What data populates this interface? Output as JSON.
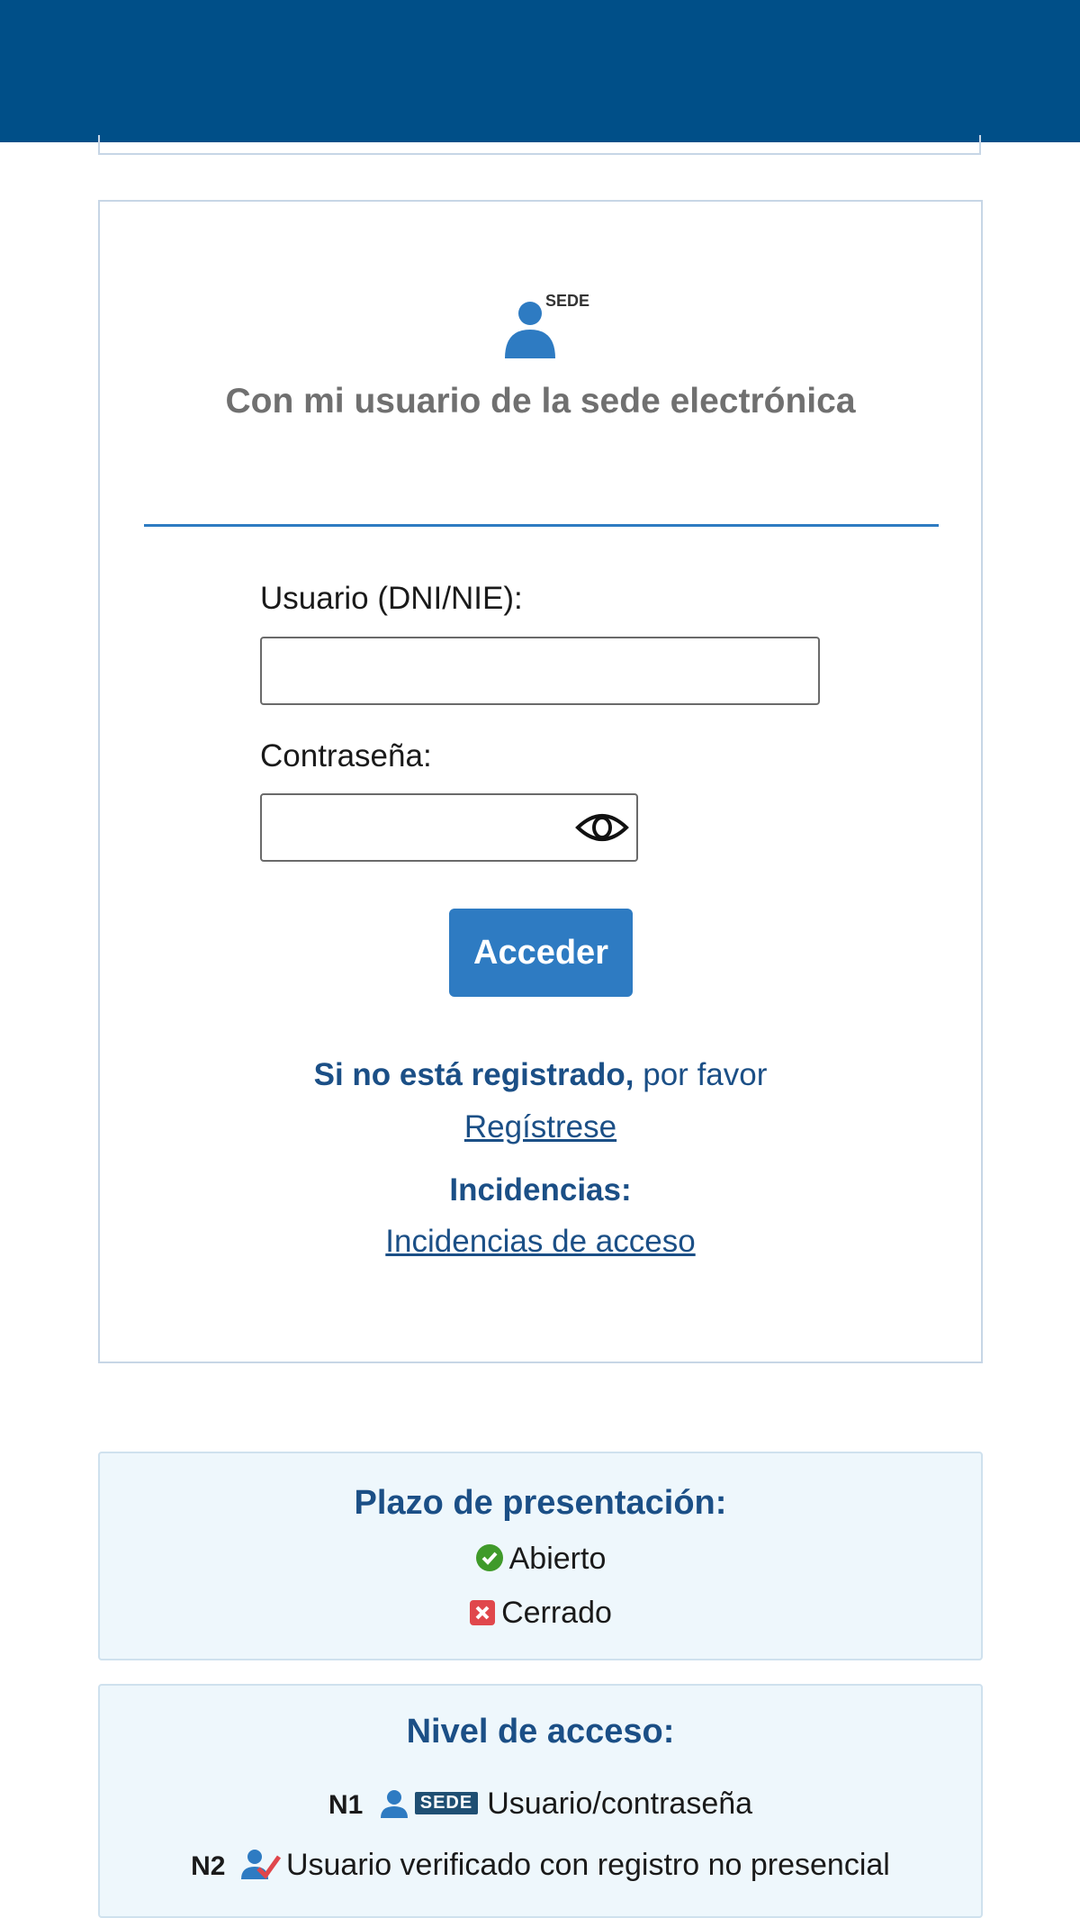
{
  "login": {
    "logo_badge": "SEDE",
    "title": "Con mi usuario de la sede electrónica",
    "user_label": "Usuario (DNI/NIE):",
    "user_value": "",
    "password_label": "Contraseña:",
    "password_value": "",
    "submit_label": "Acceder",
    "register_bold": "Si no está registrado,",
    "register_text": " por favor",
    "register_link": "Regístrese",
    "incidents_title": "Incidencias:",
    "incidents_link": "Incidencias de acceso"
  },
  "deadline": {
    "title": "Plazo de presentación:",
    "open_label": "Abierto",
    "closed_label": "Cerrado"
  },
  "access_level": {
    "title": "Nivel de acceso:",
    "levels": [
      {
        "code": "N1",
        "badge": "SEDE",
        "description": "Usuario/contraseña"
      },
      {
        "code": "N2",
        "description": "Usuario verificado con registro no presencial"
      }
    ]
  },
  "colors": {
    "header": "#004f88",
    "accent": "#2e7bc2",
    "link": "#1b4f86",
    "open": "#3f9a2a",
    "closed": "#e0474c"
  },
  "icons": {
    "sede_logo": "sede-user-icon",
    "password_toggle": "eye-icon",
    "open": "check-circle-icon",
    "closed": "close-square-icon",
    "n1": "user-icon",
    "n2": "verified-user-icon"
  }
}
